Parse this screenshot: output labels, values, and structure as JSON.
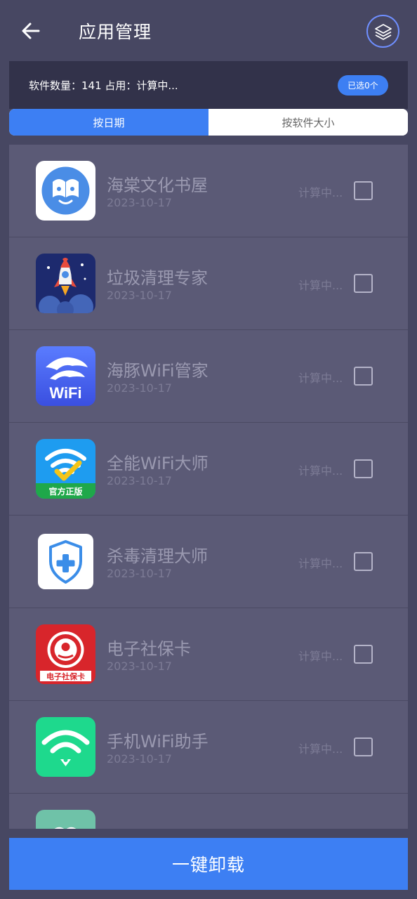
{
  "header": {
    "title": "应用管理",
    "back_icon": "arrow-left-icon",
    "layers_icon": "layers-icon"
  },
  "summary": {
    "text": "软件数量：141 占用：计算中...",
    "selected_badge": "已选0个"
  },
  "tabs": [
    {
      "label": "按日期",
      "active": true
    },
    {
      "label": "按软件大小",
      "active": false
    }
  ],
  "apps": [
    {
      "name": "海棠文化书屋",
      "date": "2023-10-17",
      "size": "计算中...",
      "icon": "haitang-app-icon"
    },
    {
      "name": "垃圾清理专家",
      "date": "2023-10-17",
      "size": "计算中...",
      "icon": "rocket-app-icon"
    },
    {
      "name": "海豚WiFi管家",
      "date": "2023-10-17",
      "size": "计算中...",
      "icon": "dolphin-wifi-app-icon",
      "icon_text": "WiFi"
    },
    {
      "name": "全能WiFi大师",
      "date": "2023-10-17",
      "size": "计算中...",
      "icon": "wifi-master-app-icon",
      "icon_text": "官方正版"
    },
    {
      "name": "杀毒清理大师",
      "date": "2023-10-17",
      "size": "计算中...",
      "icon": "shield-app-icon"
    },
    {
      "name": "电子社保卡",
      "date": "2023-10-17",
      "size": "计算中...",
      "icon": "social-security-app-icon",
      "icon_text": "电子社保卡"
    },
    {
      "name": "手机WiFi助手",
      "date": "2023-10-17",
      "size": "计算中...",
      "icon": "wifi-helper-app-icon"
    }
  ],
  "footer": {
    "uninstall_label": "一键卸载"
  },
  "colors": {
    "background": "#474762",
    "accent": "#3d7ff3",
    "list_bg": "#5b5a76",
    "summary_bg": "#32324a"
  }
}
